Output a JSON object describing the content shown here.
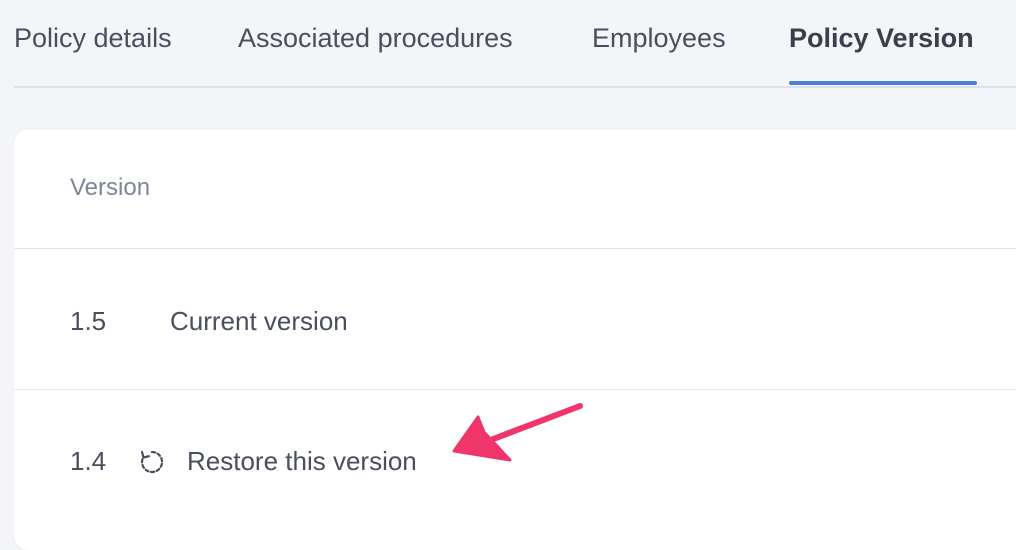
{
  "tabs": [
    {
      "label": "Policy details"
    },
    {
      "label": "Associated procedures"
    },
    {
      "label": "Employees"
    },
    {
      "label": "Policy Version"
    }
  ],
  "active_tab": "Policy Version",
  "table": {
    "header": "Version",
    "rows": [
      {
        "version": "1.5",
        "label": "Current version"
      },
      {
        "version": "1.4",
        "label": "Restore this version",
        "icon": "restore-icon"
      }
    ]
  },
  "colors": {
    "accent": "#4f7ddb",
    "annotation": "#f0356a",
    "background": "#f3f5f9"
  }
}
